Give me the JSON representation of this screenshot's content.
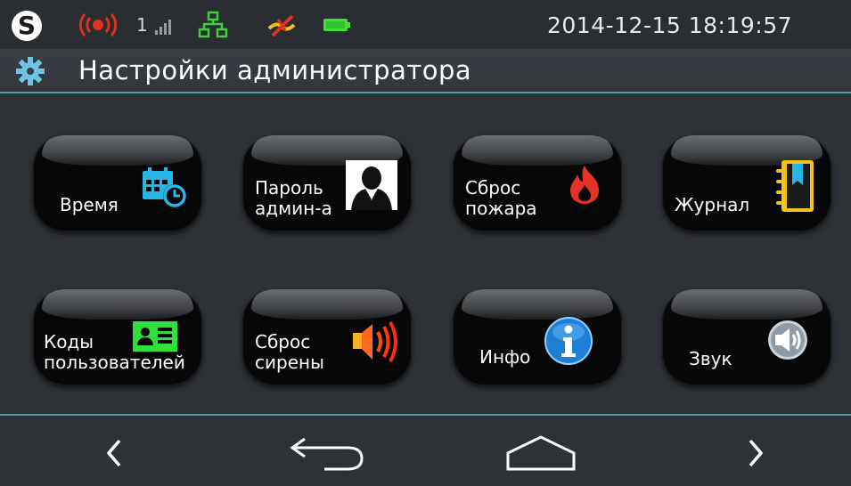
{
  "status_bar": {
    "logo_letter": "S",
    "signal_number": "1",
    "clock": "2014-12-15 18:19:57",
    "icons": [
      "alarm-broadcast-icon",
      "signal-strength-icon",
      "network-icon",
      "phone-line-disconnected-icon",
      "battery-icon"
    ]
  },
  "header": {
    "icon": "gear-icon",
    "title": "Настройки администратора"
  },
  "tiles": [
    {
      "label": "Время",
      "icon": "calendar-clock-icon"
    },
    {
      "label": "Пароль\nадмин-а",
      "icon": "user-silhouette-icon"
    },
    {
      "label": "Сброс\nпожара",
      "icon": "fire-icon"
    },
    {
      "label": "Журнал",
      "icon": "journal-icon"
    },
    {
      "label": "Коды\nпользователей",
      "icon": "id-card-icon"
    },
    {
      "label": "Сброс\nсирены",
      "icon": "siren-speaker-icon"
    },
    {
      "label": "Инфо",
      "icon": "info-icon"
    },
    {
      "label": "Звук",
      "icon": "sound-icon"
    }
  ],
  "nav": {
    "prev_glyph": "‹",
    "next_glyph": "›",
    "buttons": [
      "prev-page",
      "back",
      "home",
      "next-page"
    ]
  },
  "colors": {
    "background": "#2e3136",
    "accent_line": "#4f9bb4",
    "tile": "#070707",
    "alarm": "#e0301e",
    "network": "#3fcf3a",
    "battery": "#3fe03a",
    "calendar": "#27b5e6",
    "fire": "#e63327",
    "journal": "#f2c21a",
    "id_card": "#2fe03c",
    "siren": "#ff6a1a",
    "info": "#1f7fd6",
    "sound": "#8f9aa6"
  }
}
